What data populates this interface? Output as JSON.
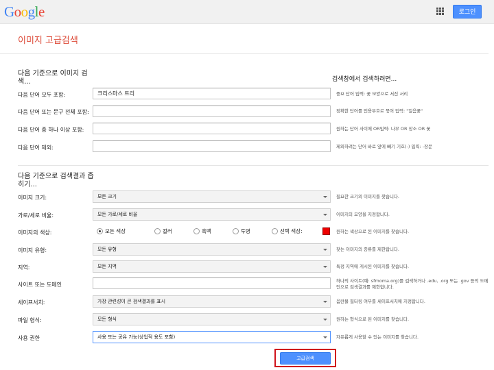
{
  "header": {
    "logo_letters": [
      {
        "ch": "G",
        "color": "#4285f4"
      },
      {
        "ch": "o",
        "color": "#ea4335"
      },
      {
        "ch": "o",
        "color": "#fbbc05"
      },
      {
        "ch": "g",
        "color": "#4285f4"
      },
      {
        "ch": "l",
        "color": "#34a853"
      },
      {
        "ch": "e",
        "color": "#ea4335"
      }
    ],
    "apps_icon": "apps-grid-icon",
    "signin_label": "로그인"
  },
  "page_title": "이미지 고급검색",
  "section1": {
    "title": "다음 기준으로 이미지 검색...",
    "right_heading": "검색창에서 검색하려면...",
    "rows": [
      {
        "label": "다음 단어 모두 포함:",
        "value": "크리스마스 트리",
        "hint": "중요 단어 입력: 꽃 모양으로 서진 서리"
      },
      {
        "label": "다음 단어 또는 문구 전체 포함:",
        "value": "",
        "hint": "정확한 단어를 인용부호로 묶어 입력: \"얼음꽃\""
      },
      {
        "label": "다음 단어 중 하나 이상 포함:",
        "value": "",
        "hint": "원하는 단어 사이에 OR입력: 나무 OR 장소 OR 꽃"
      },
      {
        "label": "다음 단어 제외:",
        "value": "",
        "hint": "제외하려는 단어 바로 앞에 빼기 기호(-) 입력: -장문"
      }
    ]
  },
  "section2": {
    "title": "다음 기준으로 검색결과 좁히기...",
    "image_size": {
      "label": "이미지 크기:",
      "value": "모든 크기",
      "hint": "필요한 크기의 이미지를 찾습니다."
    },
    "aspect": {
      "label": "가로/세로 비율:",
      "value": "모든 가로/세로 비율",
      "hint": "이미지의 모양을 지정합니다."
    },
    "color": {
      "label": "이미지의 색상:",
      "options": [
        "모든 색상",
        "컬러",
        "흑백",
        "투명",
        "선택 색상:"
      ],
      "selected_index": 0,
      "swatch_color": "#e00000",
      "hint": "원하는 색상으로 된 이미지를 찾습니다."
    },
    "type": {
      "label": "이미지 유형:",
      "value": "모든 유형",
      "hint": "찾는 이미지의 종류를 제한합니다."
    },
    "region": {
      "label": "지역:",
      "value": "모든 지역",
      "hint": "특정 지역에 게시된 이미지를 찾습니다."
    },
    "site": {
      "label": "사이트 또는 도메인",
      "value": "",
      "hint": "하나의 사이트(예: sfmoma.org)를 검색하거나 .edu, .org 또는 .gov 등의 도메인으로 검색결과를 제한합니다."
    },
    "safesearch": {
      "label": "세이프서치:",
      "value": "가장 관련성이 큰 검색결과를 표시",
      "hint": "음란물 필터링 여부를 세이프서치에 지정합니다."
    },
    "filetype": {
      "label": "파일 형식:",
      "value": "모든 형식",
      "hint": "원하는 형식으로 된 이미지를 찾습니다."
    },
    "rights": {
      "label": "사용 권한",
      "value": "사용 또는 공유 가능(상업적 용도 포함)",
      "hint": "자유롭게 사용할 수 있는 이미지를 찾습니다."
    }
  },
  "submit_label": "고급검색"
}
